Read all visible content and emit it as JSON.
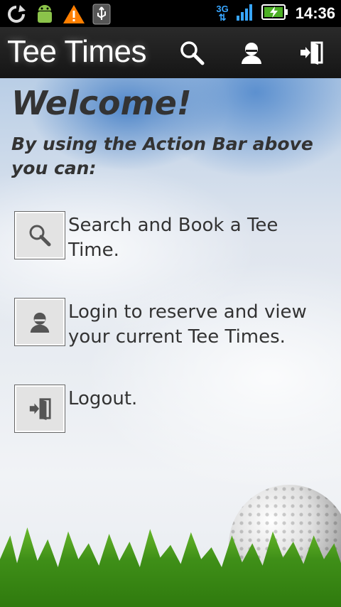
{
  "status_bar": {
    "time": "14:36",
    "network": "3G",
    "icons": [
      "sync-icon",
      "android-icon",
      "warning-icon",
      "usb-icon",
      "signal-icon",
      "battery-charging-icon"
    ]
  },
  "action_bar": {
    "title": "Tee Times",
    "actions": [
      "search-icon",
      "user-icon",
      "logout-icon"
    ]
  },
  "content": {
    "welcome": "Welcome!",
    "subtitle": "By using the Action Bar above you can:",
    "features": [
      {
        "icon": "search-icon",
        "text": "Search and Book a Tee Time."
      },
      {
        "icon": "user-icon",
        "text": "Login to reserve and view your current Tee Times."
      },
      {
        "icon": "logout-icon",
        "text": "Logout."
      }
    ]
  },
  "colors": {
    "action_bar": "#1e1e1e",
    "network_accent": "#38a6ff",
    "battery": "#4caf24",
    "warning": "#ff7f00"
  }
}
